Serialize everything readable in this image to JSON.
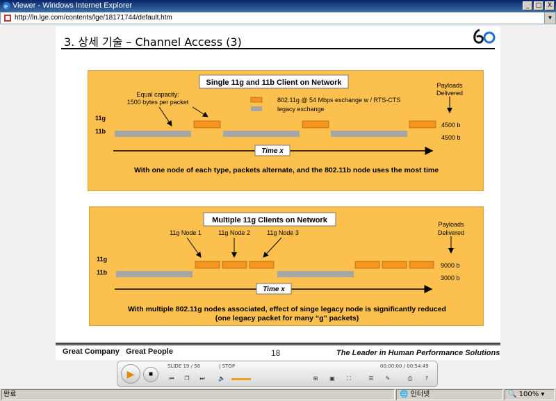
{
  "window": {
    "title": "Viewer - Windows Internet Explorer",
    "url": "http://ln.lge.com/contents/lge/18171744/default.htm",
    "controls": [
      "_",
      "□",
      "X"
    ]
  },
  "slide": {
    "title": "3. 상세 기술 – Channel Access (3)",
    "page_number": "18",
    "footer_left": "Great Company   Great People",
    "footer_right": "The Leader in Human Performance Solutions",
    "panel1": {
      "heading": "Single 11g and 11b Client on Network",
      "callout": "Equal capacity:",
      "callout2": "1500 bytes per packet",
      "legend_orange": "802.11g @ 54 Mbps exchange w / RTS-CTS",
      "legend_gray": "legacy exchange",
      "payload_label1": "Payloads",
      "payload_label2": "Delivered",
      "row_11g": "11g",
      "row_11b": "11b",
      "payload_11g": "4500 b",
      "payload_11b": "4500 b",
      "time_label": "Time x",
      "caption": "With one node of each type, packets alternate, and the 802.11b node uses the most time"
    },
    "panel2": {
      "heading": "Multiple 11g Clients on Network",
      "node1": "11g Node 1",
      "node2": "11g Node 2",
      "node3": "11g Node 3",
      "payload_label1": "Payloads",
      "payload_label2": "Delivered",
      "row_11g": "11g",
      "row_11b": "11b",
      "payload_11g": "9000 b",
      "payload_11b": "3000 b",
      "time_label": "Time x",
      "caption1": "With multiple 802.11g nodes associated, effect of singe legacy node is significantly reduced",
      "caption2": "(one legacy packet for many “g” packets)"
    }
  },
  "player": {
    "slide_info": "SLIDE  19 / 58",
    "state": "| STOP",
    "time": "00:00:00 / 00:54:49"
  },
  "statusbar": {
    "status": "완료",
    "zone": "인터넷",
    "zoom": "100%"
  },
  "colors": {
    "panel_bg": "#fcc04f",
    "packet_orange": "#f7941d",
    "packet_gray": "#a6a6a6"
  }
}
